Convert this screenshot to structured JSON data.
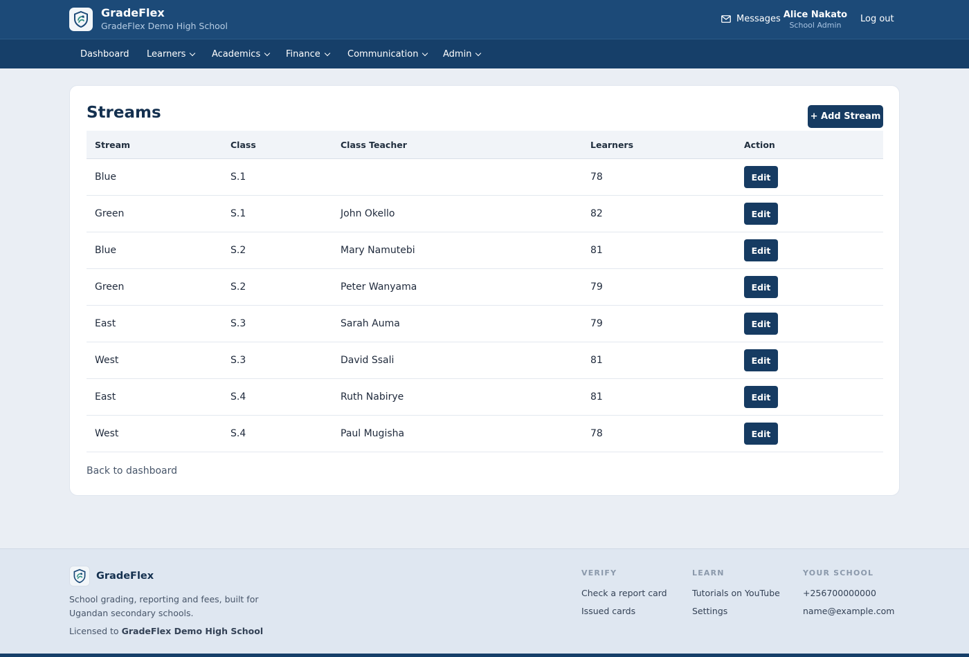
{
  "header": {
    "brand": "GradeFlex",
    "school": "GradeFlex Demo High School",
    "messages": "Messages",
    "user_name": "Alice Nakato",
    "user_role": "School Admin",
    "logout": "Log out"
  },
  "nav": [
    "Dashboard",
    "Learners",
    "Academics",
    "Finance",
    "Communication",
    "Admin"
  ],
  "page": {
    "title": "Streams",
    "add_button": "+ Add Stream",
    "back_link": "Back to dashboard"
  },
  "table": {
    "columns": [
      "Stream",
      "Class",
      "Class Teacher",
      "Learners",
      "Action"
    ],
    "edit_label": "Edit",
    "rows": [
      {
        "stream": "Blue",
        "class": "S.1",
        "teacher": "",
        "learners": "78"
      },
      {
        "stream": "Green",
        "class": "S.1",
        "teacher": "John Okello",
        "learners": "82"
      },
      {
        "stream": "Blue",
        "class": "S.2",
        "teacher": "Mary Namutebi",
        "learners": "81"
      },
      {
        "stream": "Green",
        "class": "S.2",
        "teacher": "Peter Wanyama",
        "learners": "79"
      },
      {
        "stream": "East",
        "class": "S.3",
        "teacher": "Sarah Auma",
        "learners": "79"
      },
      {
        "stream": "West",
        "class": "S.3",
        "teacher": "David Ssali",
        "learners": "81"
      },
      {
        "stream": "East",
        "class": "S.4",
        "teacher": "Ruth Nabirye",
        "learners": "81"
      },
      {
        "stream": "West",
        "class": "S.4",
        "teacher": "Paul Mugisha",
        "learners": "78"
      }
    ]
  },
  "footer": {
    "brand": "GradeFlex",
    "tagline": "School grading, reporting and fees, built for Ugandan secondary schools.",
    "license_prefix": "Licensed to",
    "license_school": "GradeFlex Demo High School",
    "columns": [
      {
        "heading": "VERIFY",
        "links": [
          "Check a report card",
          "Issued cards"
        ]
      },
      {
        "heading": "LEARN",
        "links": [
          "Tutorials on YouTube",
          "Settings"
        ]
      },
      {
        "heading": "YOUR SCHOOL",
        "links": [
          "+256700000000",
          "name@example.com"
        ]
      }
    ]
  },
  "colors": {
    "header_bg": "#1c4a78",
    "nav_bg": "#163f69",
    "button_bg": "#163b62",
    "page_bg": "#eaeef4",
    "footer_bg": "#dfe7f1"
  }
}
